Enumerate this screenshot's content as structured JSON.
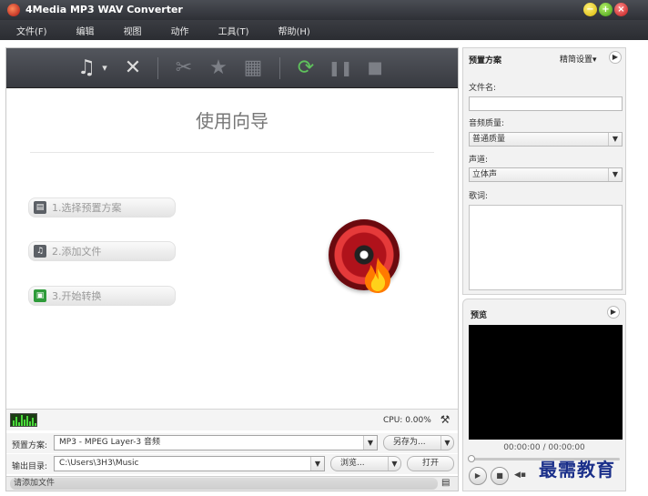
{
  "window": {
    "title": "4Media MP3 WAV Converter",
    "controls": {
      "minimize": "−",
      "maximize": "+",
      "close": "×"
    }
  },
  "menu": [
    "文件(F)",
    "编辑",
    "视图",
    "动作",
    "工具(T)",
    "帮助(H)"
  ],
  "toolbar": {
    "add_file": "♫",
    "add_dropdown": "▾",
    "remove": "✕",
    "clip": "✂",
    "effects": "★",
    "add_segment": "▦",
    "convert": "⟳",
    "pause": "❚❚",
    "stop": "■"
  },
  "wizard": {
    "title": "使用向导",
    "steps": [
      {
        "label": "1.选择预置方案",
        "icon": "preset-icon",
        "glyph": "▤"
      },
      {
        "label": "2.添加文件",
        "icon": "music-file-icon",
        "glyph": "♫"
      },
      {
        "label": "3.开始转换",
        "icon": "convert-icon",
        "glyph": "▣"
      }
    ]
  },
  "status": {
    "cpu": "CPU: 0.00%"
  },
  "preset_row": {
    "label": "预置方案:",
    "value": "MP3 - MPEG Layer-3 音频",
    "save_as": "另存为..."
  },
  "output_row": {
    "label": "输出目录:",
    "value": "C:\\Users\\3H3\\Music",
    "browse": "浏览...",
    "open": "打开"
  },
  "bottom": {
    "message": "请添加文件"
  },
  "right_panel": {
    "title": "预置方案",
    "advanced": "精简设置▾",
    "filename_label": "文件名:",
    "filename_value": "",
    "quality_label": "音频质量:",
    "quality_value": "普通质量",
    "channel_label": "声道:",
    "channel_value": "立体声",
    "lyrics_label": "歌词:"
  },
  "preview": {
    "title": "预览",
    "time": "00:00:00 / 00:00:00"
  },
  "watermark": "最需教育",
  "colors": {
    "toolbar_bg": "#45484e",
    "accent_green": "#5fc25c",
    "title_bg": "#2e3036"
  }
}
